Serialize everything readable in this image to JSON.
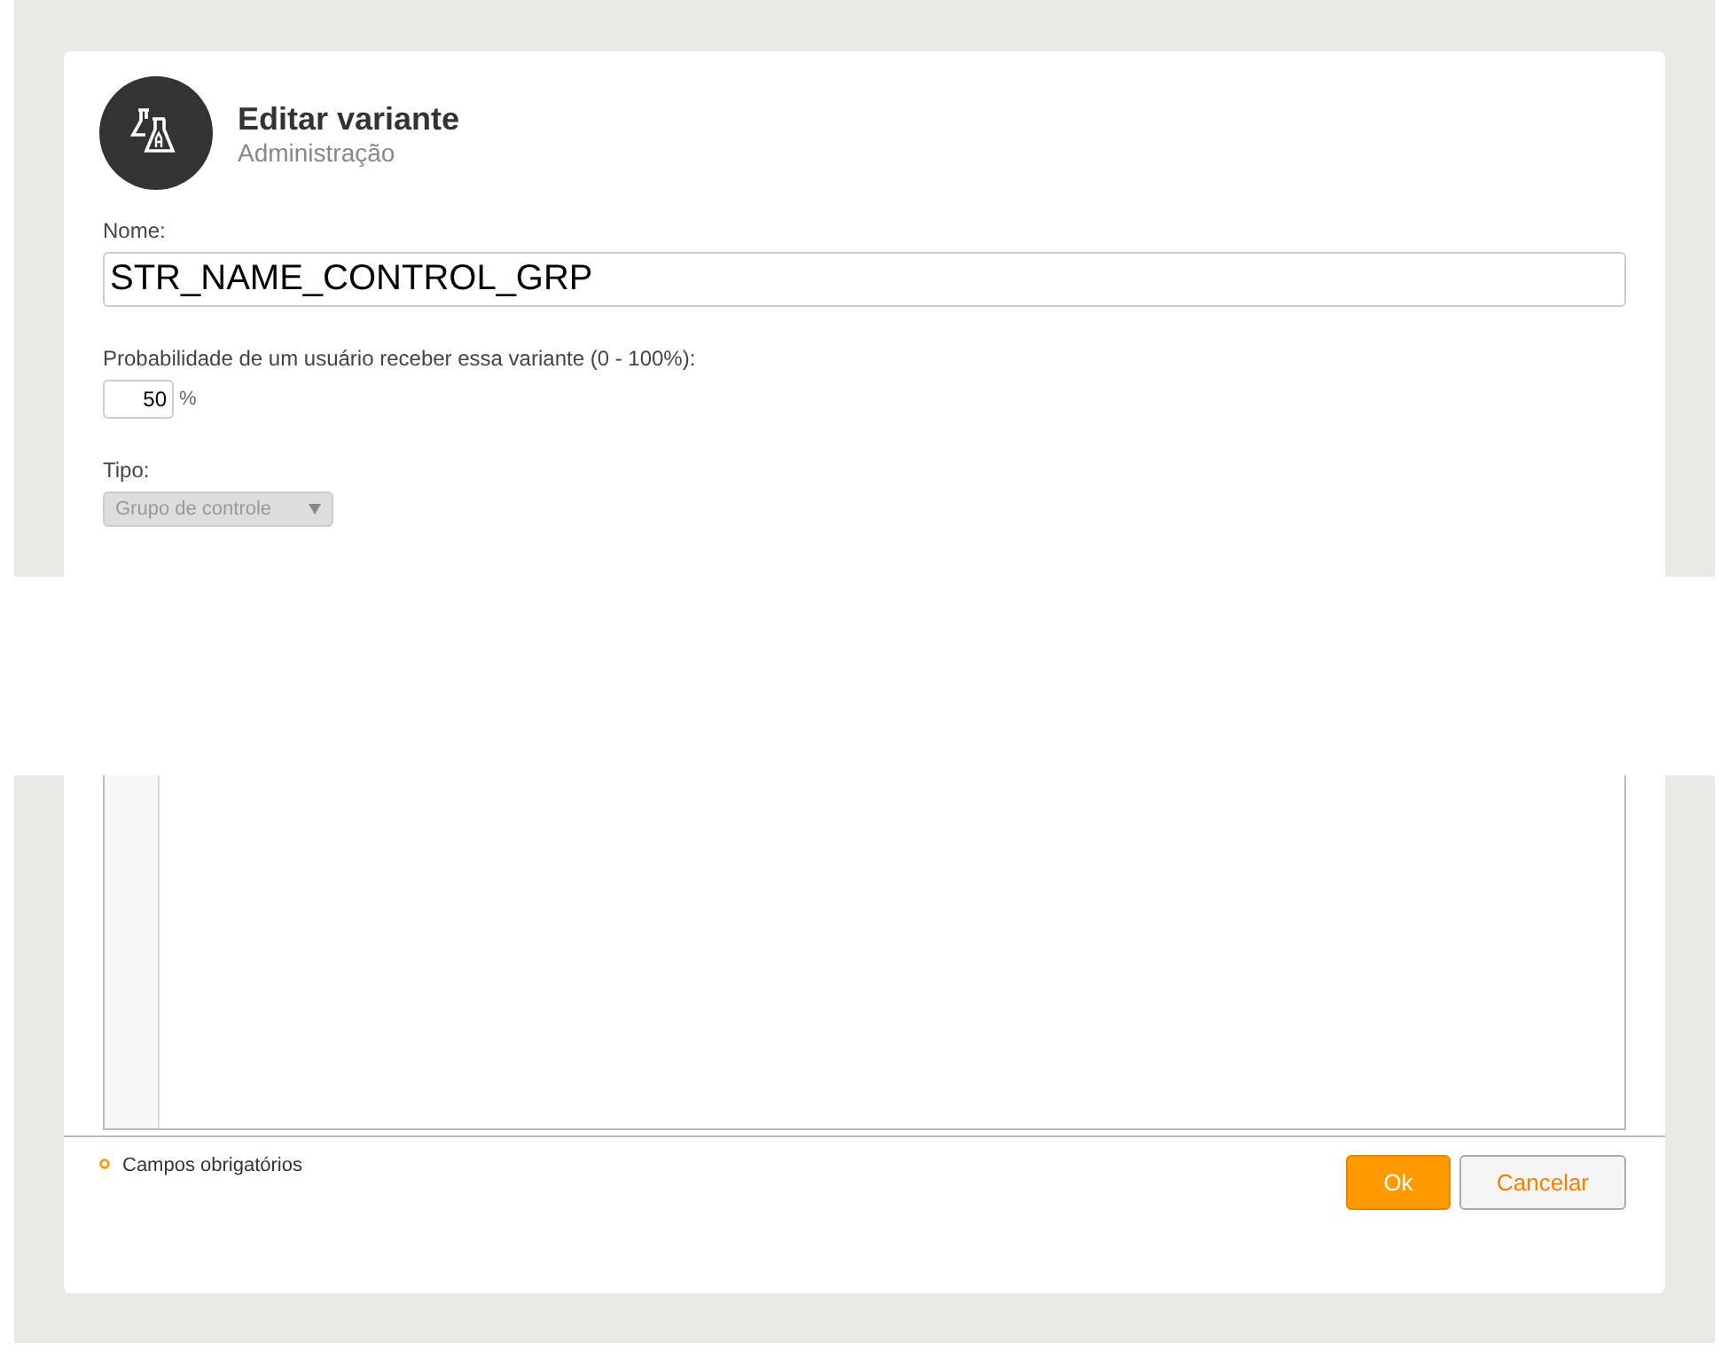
{
  "header": {
    "title": "Editar variante",
    "subtitle": "Administração"
  },
  "name_field": {
    "label": "Nome:",
    "value": "STR_NAME_CONTROL_GRP"
  },
  "probability_field": {
    "label": "Probabilidade de um usuário receber essa variante (0 - 100%):",
    "value": "50",
    "unit": "%"
  },
  "type_field": {
    "label": "Tipo:",
    "value": "Grupo de controle",
    "disabled": true
  },
  "footer": {
    "required_note": "Campos obrigatórios",
    "buttons": [
      {
        "label": "Ok",
        "kind": "primary"
      },
      {
        "label": "Cancelar",
        "kind": "secondary"
      }
    ]
  }
}
